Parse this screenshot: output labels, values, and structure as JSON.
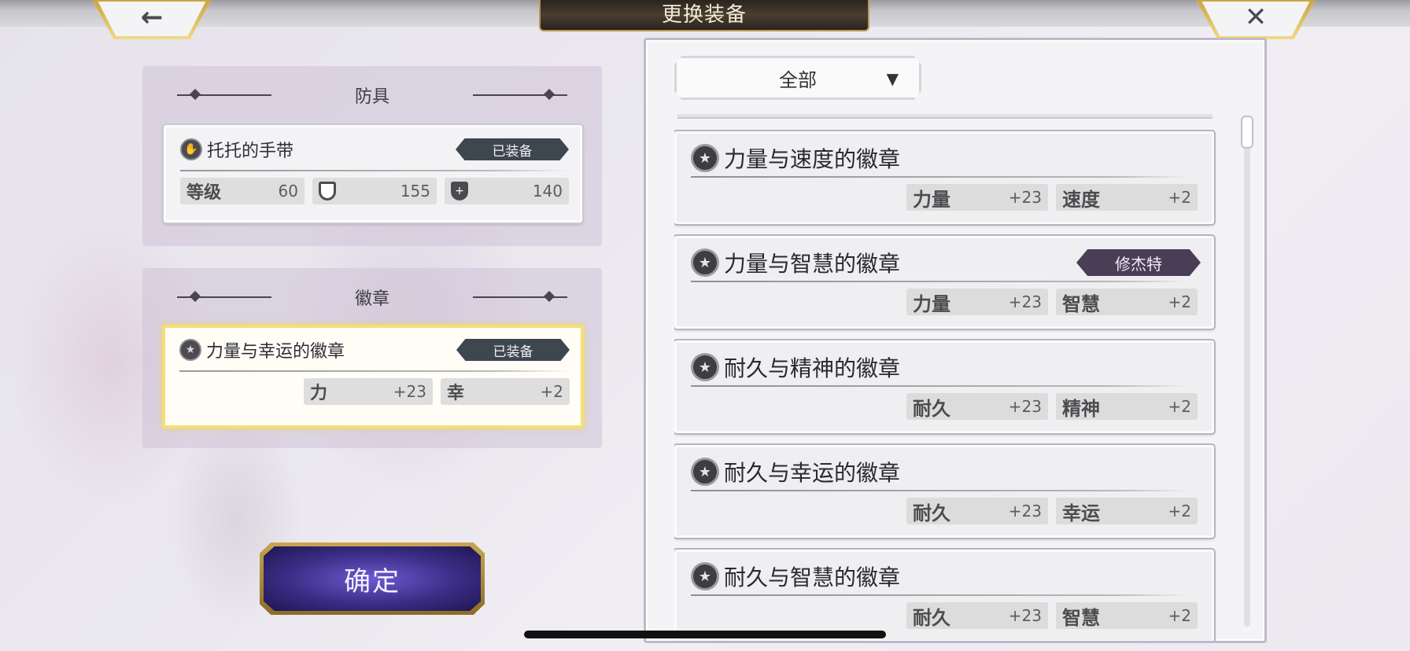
{
  "header": {
    "title": "更换装备",
    "back_glyph": "←",
    "close_glyph": "✕"
  },
  "armor_section": {
    "title": "防具",
    "item": {
      "icon": "glove-icon",
      "name": "托托的手带",
      "status": "已装备",
      "stats": [
        {
          "label": "等级",
          "value": "60"
        },
        {
          "icon": "shield-outline-icon",
          "value": "155"
        },
        {
          "icon": "shield-plus-icon",
          "value": "140"
        }
      ]
    }
  },
  "badge_section": {
    "title": "徽章",
    "item": {
      "icon": "star-badge-icon",
      "name": "力量与幸运的徽章",
      "status": "已装备",
      "stats": [
        {
          "label": "力",
          "value": "+23"
        },
        {
          "label": "幸",
          "value": "+2"
        }
      ]
    }
  },
  "confirm_label": "确定",
  "filter": {
    "selected": "全部",
    "arrow": "▼"
  },
  "badge_list": [
    {
      "name": "力量与速度的徽章",
      "owner": "",
      "stats": [
        {
          "label": "力量",
          "value": "+23"
        },
        {
          "label": "速度",
          "value": "+2"
        }
      ]
    },
    {
      "name": "力量与智慧的徽章",
      "owner": "修杰特",
      "stats": [
        {
          "label": "力量",
          "value": "+23"
        },
        {
          "label": "智慧",
          "value": "+2"
        }
      ]
    },
    {
      "name": "耐久与精神的徽章",
      "owner": "",
      "stats": [
        {
          "label": "耐久",
          "value": "+23"
        },
        {
          "label": "精神",
          "value": "+2"
        }
      ]
    },
    {
      "name": "耐久与幸运的徽章",
      "owner": "",
      "stats": [
        {
          "label": "耐久",
          "value": "+23"
        },
        {
          "label": "幸运",
          "value": "+2"
        }
      ]
    },
    {
      "name": "耐久与智慧的徽章",
      "owner": "",
      "stats": [
        {
          "label": "耐久",
          "value": "+23"
        },
        {
          "label": "智慧",
          "value": "+2"
        }
      ]
    }
  ],
  "colors": {
    "accent_gold": "#f6de76",
    "owner_tag": "#4a3e56",
    "equipped_tag": "#3e4650",
    "confirm_purple": "#3b2d86"
  }
}
